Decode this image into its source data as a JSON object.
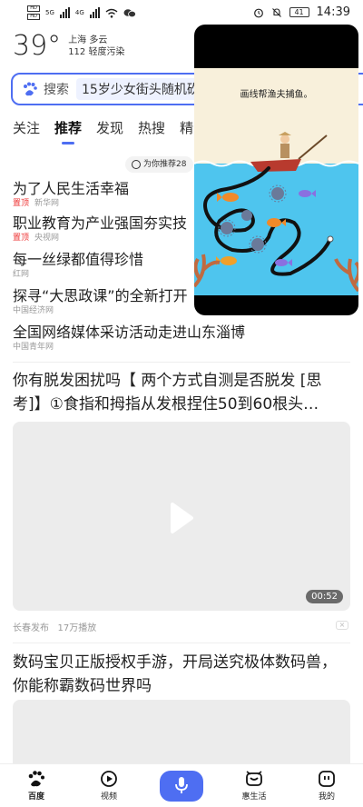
{
  "status_bar": {
    "sim_labels": [
      "HD",
      "HD"
    ],
    "network": [
      "5G",
      "4G"
    ],
    "battery": "41",
    "time": "14:39"
  },
  "weather": {
    "temperature": "39°",
    "location_condition": "上海 多云",
    "air_quality": "112 轻度污染"
  },
  "search": {
    "label": "搜索",
    "query": "15岁少女街头随机砍"
  },
  "tabs": [
    "关注",
    "推荐",
    "发现",
    "热搜",
    "精"
  ],
  "active_tab": "推荐",
  "recommend_pill": "为你推荐28",
  "news": [
    {
      "title": "为了人民生活幸福",
      "tag": "置顶",
      "source": "新华网"
    },
    {
      "title": "职业教育为产业强国夯实技",
      "tag": "置顶",
      "source": "央视网"
    },
    {
      "title": "每一丝绿都值得珍惜",
      "tag": "",
      "source": "红网"
    },
    {
      "title": "探寻“大思政课”的全新打开",
      "tag": "",
      "source": "中国经济网"
    },
    {
      "title": "全国网络媒体采访活动走进山东淄博",
      "tag": "",
      "source": "中国青年网"
    }
  ],
  "video_card": {
    "title": "你有脱发困扰吗【 两个方式自测是否脱发 [思考]】①食指和拇指从发根捏住50到60根头…",
    "duration": "00:52",
    "publisher": "长春发布",
    "plays": "17万播放"
  },
  "second_card": {
    "title": "数码宝贝正版授权手游，开局送究极体数码兽，你能称霸数码世界吗"
  },
  "game": {
    "instruction": "画线帮渔夫捕鱼。"
  },
  "bottom_nav": [
    {
      "label": "百度",
      "icon": "baidu-paw-icon"
    },
    {
      "label": "视频",
      "icon": "video-play-icon"
    },
    {
      "label": "",
      "icon": "microphone-icon"
    },
    {
      "label": "惠生活",
      "icon": "hui-life-icon"
    },
    {
      "label": "我的",
      "icon": "profile-face-icon"
    }
  ],
  "colors": {
    "accent": "#4e6ef2",
    "top_tag": "#e33333"
  }
}
